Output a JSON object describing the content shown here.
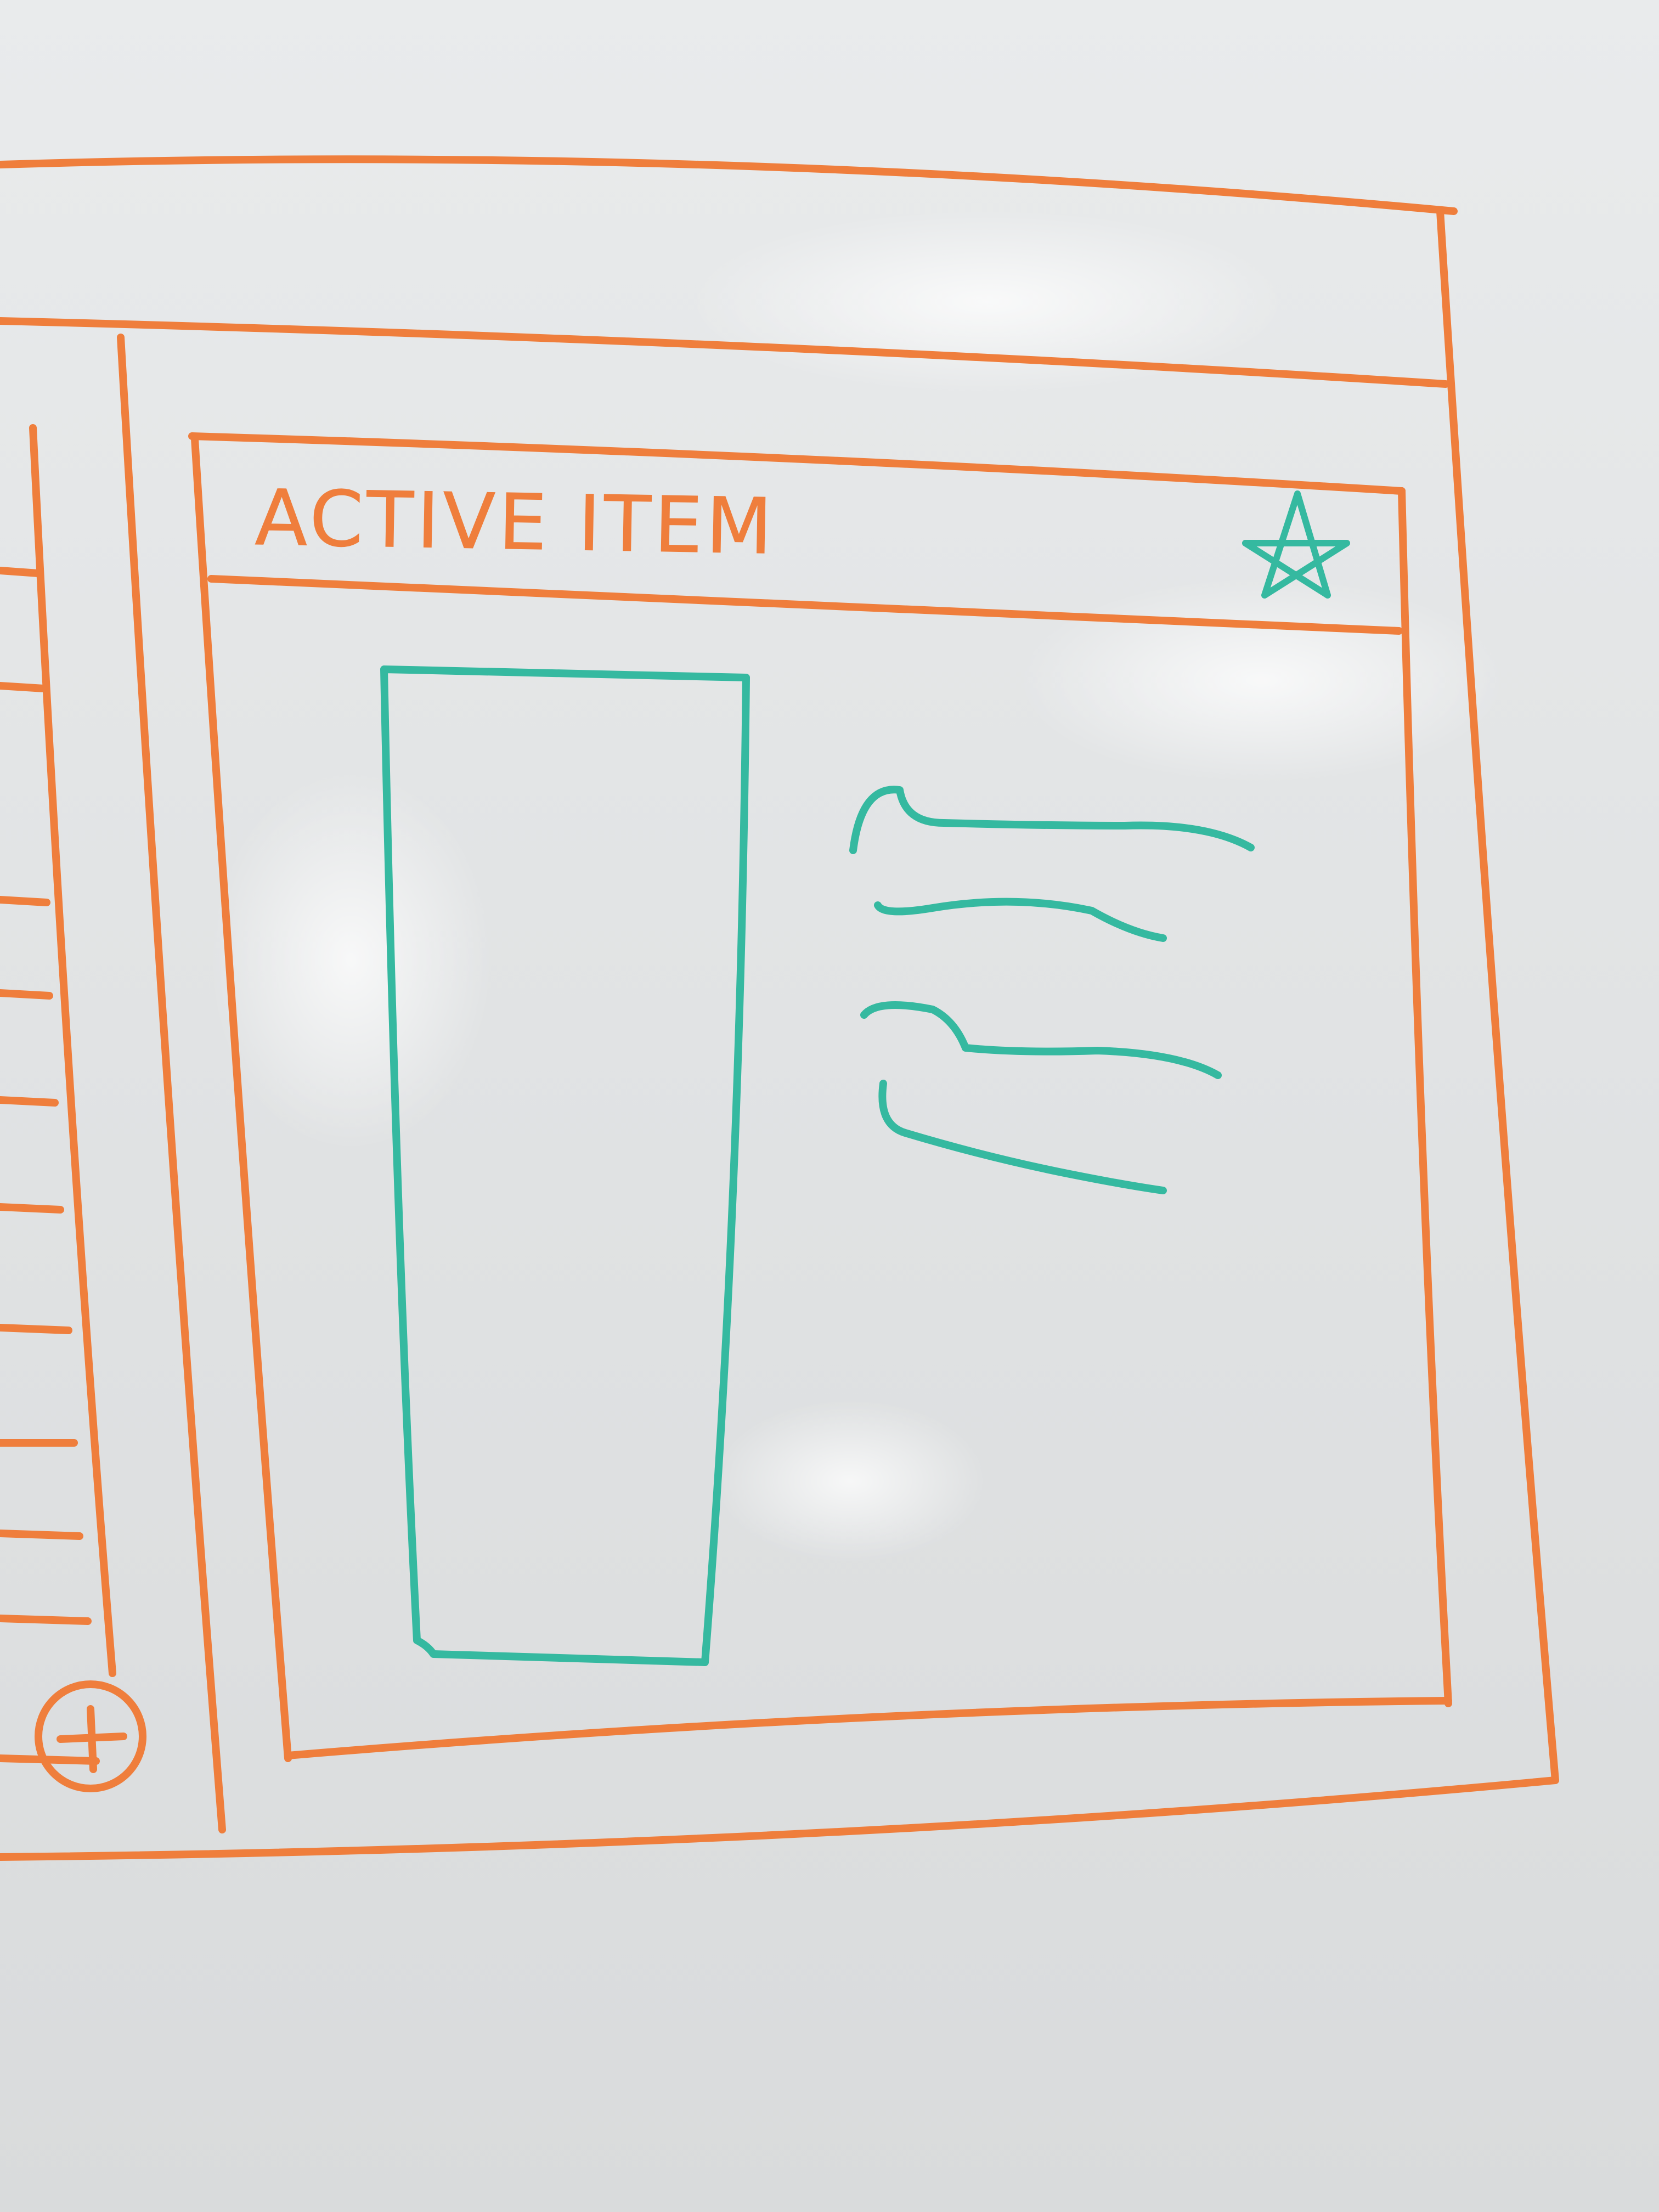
{
  "active_panel": {
    "title": "ACTIVE ITEM",
    "favorite_icon": "star-icon"
  },
  "sidebar": {
    "add_icon": "plus-circle-icon"
  },
  "colors": {
    "orange_marker": "#ef7e3c",
    "teal_marker": "#35b9a0",
    "board": "#e6e8e9"
  }
}
